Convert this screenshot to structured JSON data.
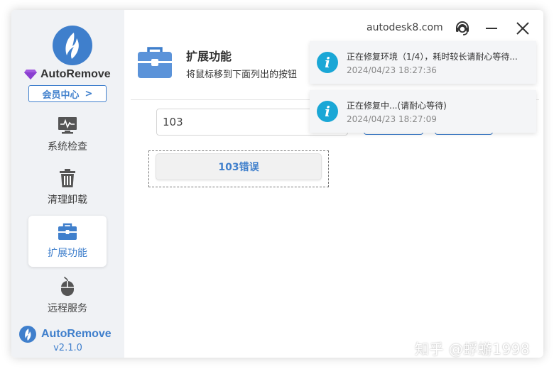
{
  "app": {
    "name": "AutoRemove",
    "member_label": "会员中心",
    "member_arrow": ">",
    "site": "autodesk8.com",
    "version": "v2.1.0"
  },
  "nav": {
    "items": [
      {
        "label": "系统检查",
        "icon": "monitor-pulse-icon"
      },
      {
        "label": "清理卸载",
        "icon": "trash-icon"
      },
      {
        "label": "扩展功能",
        "icon": "toolbox-icon"
      },
      {
        "label": "远程服务",
        "icon": "mouse-icon"
      }
    ],
    "active": "扩展功能"
  },
  "header": {
    "title": "扩展功能",
    "description": "将鼠标移到下面列出的按钮"
  },
  "search": {
    "value": "103"
  },
  "result": {
    "button_label": "103错误"
  },
  "toasts": [
    {
      "message": "正在修复环境（1/4），耗时较长请耐心等待...",
      "time": "2024/04/23 18:27:36",
      "icon": "info-icon"
    },
    {
      "message": "正在修复中...(请耐心等待)",
      "time": "2024/04/23 18:27:09",
      "icon": "info-icon"
    }
  ],
  "watermark": "知乎 @蜉蝣1998",
  "colors": {
    "accent": "#3f7fcc",
    "info": "#1aa7d6",
    "sidebar_bg": "#f0f2f5"
  }
}
